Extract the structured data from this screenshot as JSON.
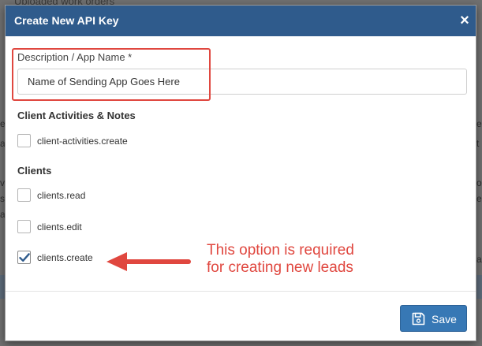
{
  "background": {
    "top_peek": "Uploaded work orders",
    "left_peek": [
      "e",
      "a",
      "v",
      "s",
      "a"
    ],
    "right_peek": [
      "e",
      "t",
      "o",
      "e",
      "a"
    ]
  },
  "modal": {
    "title": "Create New API Key",
    "close_glyph": "×"
  },
  "form": {
    "description_label": "Description / App Name *",
    "description_value": "Name of Sending App Goes Here"
  },
  "sections": [
    {
      "heading": "Client Activities & Notes",
      "permissions": [
        {
          "label": "client-activities.create",
          "checked": false
        }
      ]
    },
    {
      "heading": "Clients",
      "permissions": [
        {
          "label": "clients.read",
          "checked": false
        },
        {
          "label": "clients.edit",
          "checked": false
        },
        {
          "label": "clients.create",
          "checked": true
        }
      ]
    }
  ],
  "footer": {
    "save_label": "Save",
    "save_icon": "floppy-disk-icon"
  },
  "annotation": {
    "line1": "This option is required",
    "line2": "for creating new leads"
  },
  "colors": {
    "header": "#2f5b8c",
    "primary_button": "#3778b5",
    "annotation": "#e0473f",
    "checkmark": "#2f5b8c"
  }
}
